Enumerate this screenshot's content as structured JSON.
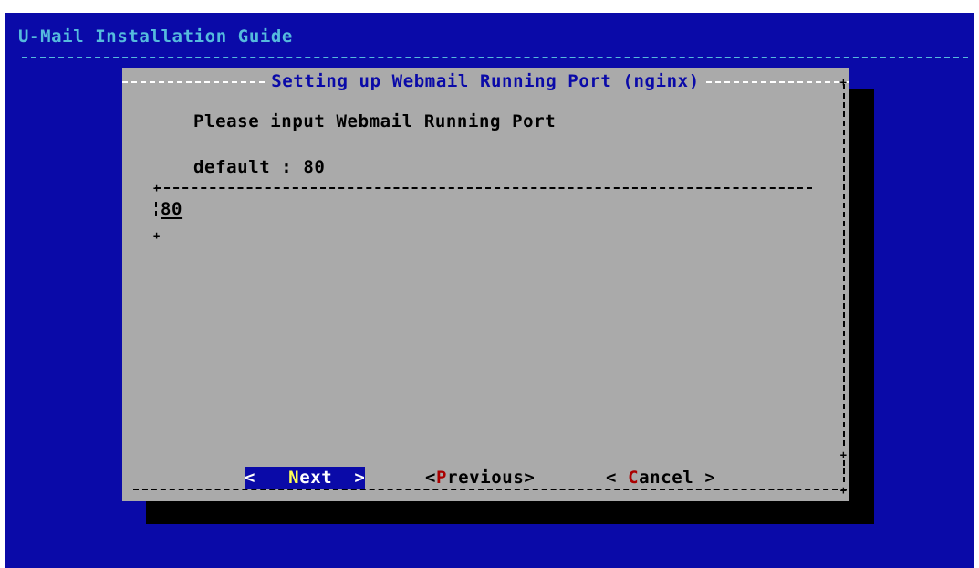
{
  "backtitle": "U-Mail Installation Guide",
  "dialog": {
    "title": "Setting up Webmail Running Port (nginx)",
    "prompt": "Please input Webmail Running Port",
    "default_text": "default : 80",
    "input_value": "80"
  },
  "buttons": {
    "next": {
      "open": "<",
      "hotkey": "N",
      "rest": "ext",
      "close": ">"
    },
    "previous": {
      "open": "<",
      "hotkey": "P",
      "rest": "revious",
      "close": ">"
    },
    "cancel": {
      "open": "< ",
      "hotkey": "C",
      "rest": "ancel",
      "close": " >"
    }
  },
  "colors": {
    "background": "#0a0aa8",
    "dialog": "#aaaaaa",
    "shadow": "#000000",
    "backtitle": "#55bbdd",
    "hotkey_selected": "#ffff55",
    "hotkey": "#aa0000"
  }
}
